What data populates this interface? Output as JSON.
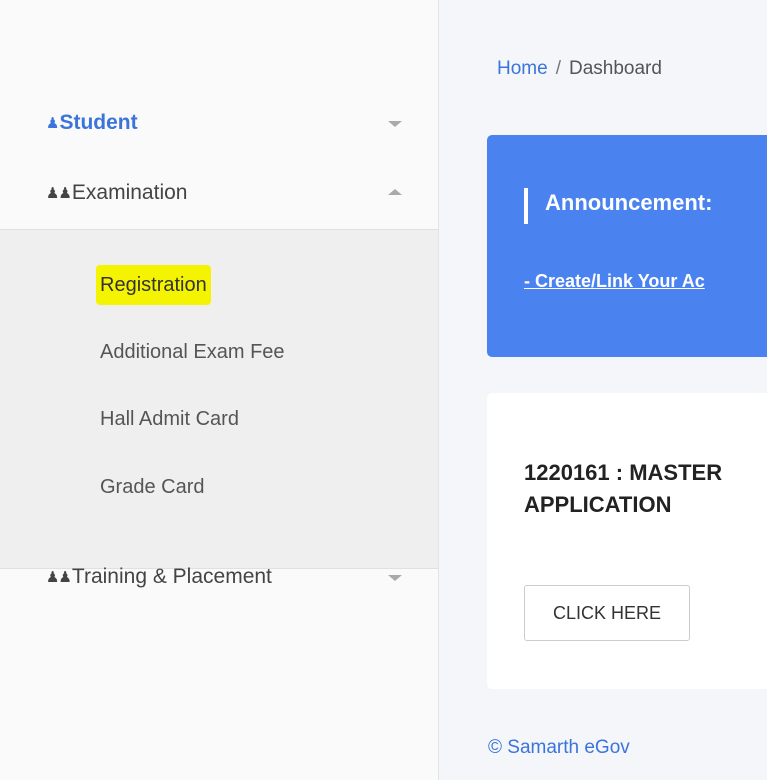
{
  "sidebar": {
    "student": {
      "icon": "person-icon",
      "label": "Student"
    },
    "examination": {
      "icon": "people-icon",
      "label": "Examination",
      "submenu": [
        "Registration",
        "Additional Exam Fee",
        "Hall Admit Card",
        "Grade Card"
      ]
    },
    "training": {
      "icon": "people-icon",
      "label": "Training & Placement"
    }
  },
  "breadcrumb": {
    "home": "Home",
    "separator": "/",
    "current": "Dashboard"
  },
  "announcement": {
    "title": "Announcement:",
    "link_text": "- Create/Link Your Ac"
  },
  "card": {
    "heading_line1": "1220161 : MASTER",
    "heading_line2": "APPLICATION",
    "button_label": "CLICK HERE"
  },
  "footer": {
    "text": "© Samarth eGov"
  },
  "colors": {
    "accent": "#3b74db",
    "announcement_bg": "#4a83f0",
    "highlight": "#f4f400"
  }
}
